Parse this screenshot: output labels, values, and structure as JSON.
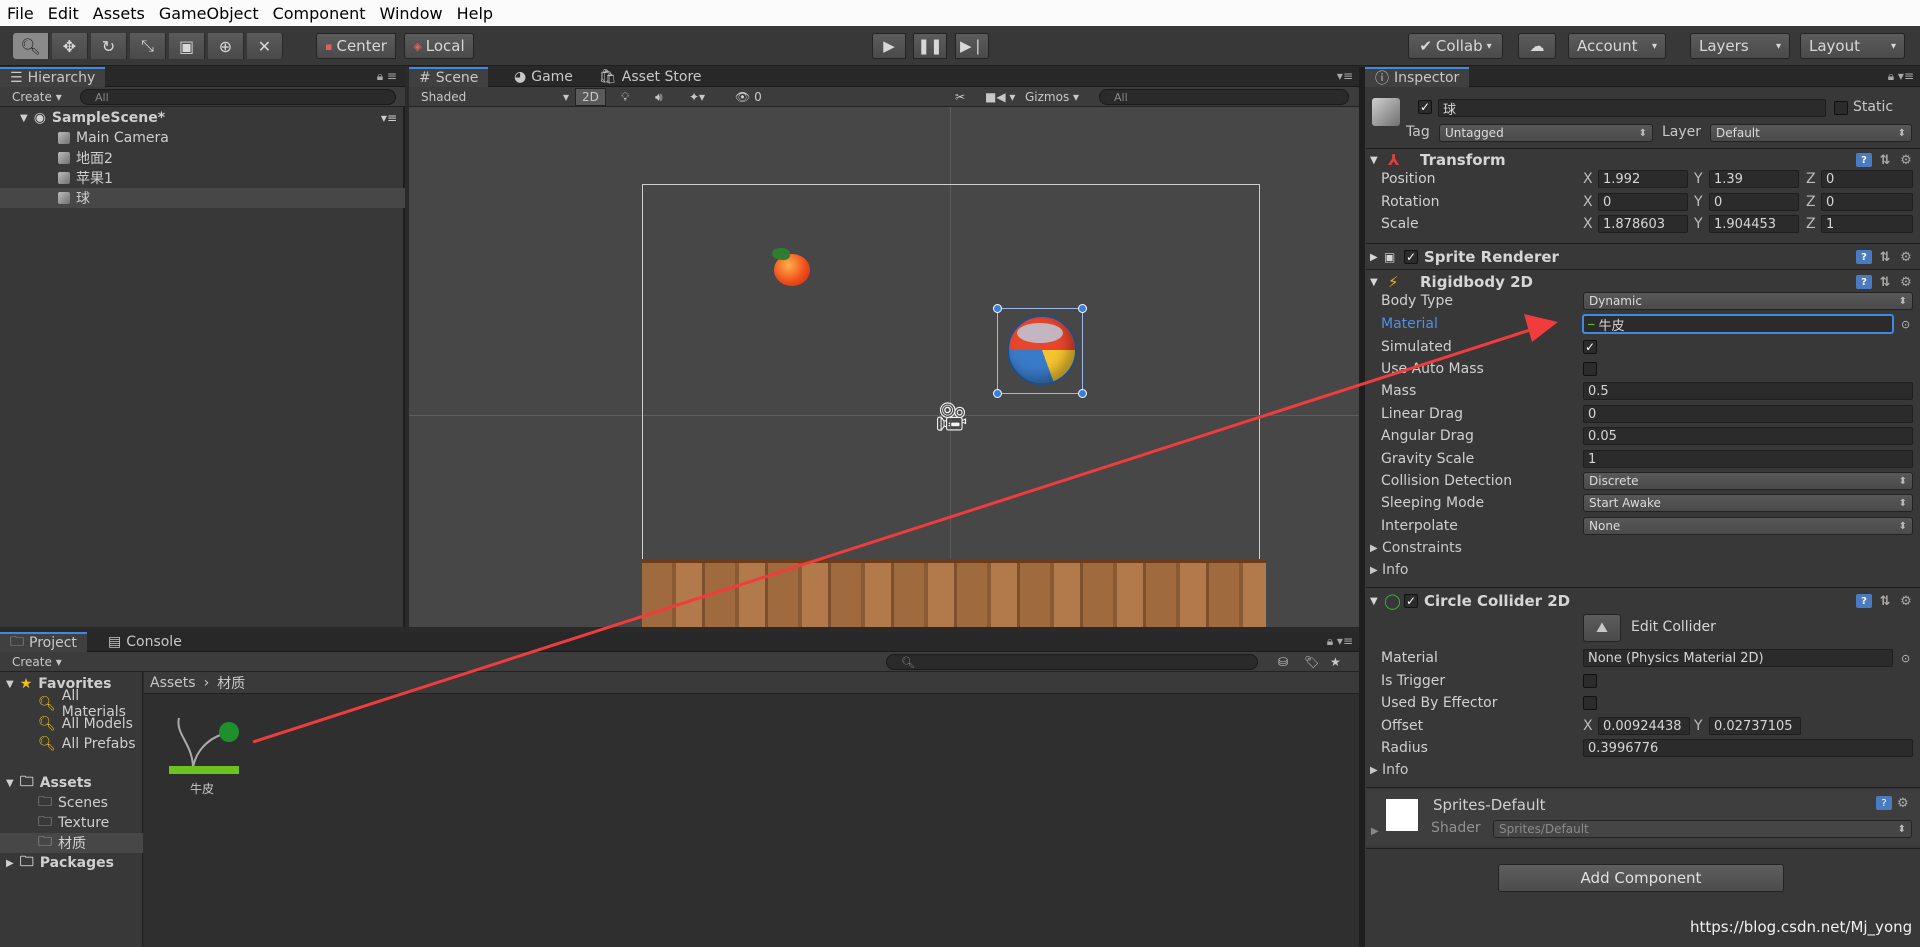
{
  "menu": [
    "File",
    "Edit",
    "Assets",
    "GameObject",
    "Component",
    "Window",
    "Help"
  ],
  "toolbar": {
    "pivot": "Center",
    "space": "Local",
    "collab": "Collab",
    "account": "Account",
    "layers": "Layers",
    "layout": "Layout"
  },
  "hierarchy": {
    "tab": "Hierarchy",
    "create": "Create",
    "search_placeholder": "All",
    "scene": "SampleScene*",
    "items": [
      "Main Camera",
      "地面2",
      "苹果1",
      "球"
    ]
  },
  "scene_view": {
    "tabs": [
      "Scene",
      "Game",
      "Asset Store"
    ],
    "shading": "Shaded",
    "mode2d": "2D",
    "hidden_count": "0",
    "gizmos": "Gizmos",
    "search_placeholder": "All"
  },
  "project": {
    "tabs": [
      "Project",
      "Console"
    ],
    "create": "Create",
    "favorites_label": "Favorites",
    "favorites": [
      "All Materials",
      "All Models",
      "All Prefabs"
    ],
    "assets_label": "Assets",
    "folders": [
      "Scenes",
      "Texture",
      "材质"
    ],
    "packages_label": "Packages",
    "breadcrumb": [
      "Assets",
      "材质"
    ],
    "asset_name": "牛皮"
  },
  "inspector": {
    "tab": "Inspector",
    "object_name": "球",
    "static_label": "Static",
    "tag_label": "Tag",
    "tag_value": "Untagged",
    "layer_label": "Layer",
    "layer_value": "Default",
    "transform": {
      "title": "Transform",
      "position_label": "Position",
      "rotation_label": "Rotation",
      "scale_label": "Scale",
      "position": {
        "x": "1.992",
        "y": "1.39",
        "z": "0"
      },
      "rotation": {
        "x": "0",
        "y": "0",
        "z": "0"
      },
      "scale": {
        "x": "1.878603",
        "y": "1.904453",
        "z": "1"
      }
    },
    "sprite_renderer": {
      "title": "Sprite Renderer"
    },
    "rigidbody": {
      "title": "Rigidbody 2D",
      "body_type_label": "Body Type",
      "body_type": "Dynamic",
      "material_label": "Material",
      "material": "牛皮",
      "simulated_label": "Simulated",
      "auto_mass_label": "Use Auto Mass",
      "mass_label": "Mass",
      "mass": "0.5",
      "linear_drag_label": "Linear Drag",
      "linear_drag": "0",
      "angular_drag_label": "Angular Drag",
      "angular_drag": "0.05",
      "gravity_label": "Gravity Scale",
      "gravity": "1",
      "collision_label": "Collision Detection",
      "collision": "Discrete",
      "sleeping_label": "Sleeping Mode",
      "sleeping": "Start Awake",
      "interpolate_label": "Interpolate",
      "interpolate": "None",
      "constraints_label": "Constraints",
      "info_label": "Info"
    },
    "circle_collider": {
      "title": "Circle Collider 2D",
      "edit_collider": "Edit Collider",
      "material_label": "Material",
      "material": "None (Physics Material 2D)",
      "is_trigger_label": "Is Trigger",
      "used_by_effector_label": "Used By Effector",
      "offset_label": "Offset",
      "offset": {
        "x": "0.00924438",
        "y": "0.02737105"
      },
      "radius_label": "Radius",
      "radius": "0.3996776",
      "info_label": "Info"
    },
    "material_block": {
      "name": "Sprites-Default",
      "shader_label": "Shader",
      "shader": "Sprites/Default"
    },
    "add_component": "Add Component"
  },
  "watermark": "https://blog.csdn.net/Mj_yong",
  "colors": {
    "accent": "#3f8ae0",
    "arrow": "#f03c3c",
    "selection": "#3e5f96"
  }
}
